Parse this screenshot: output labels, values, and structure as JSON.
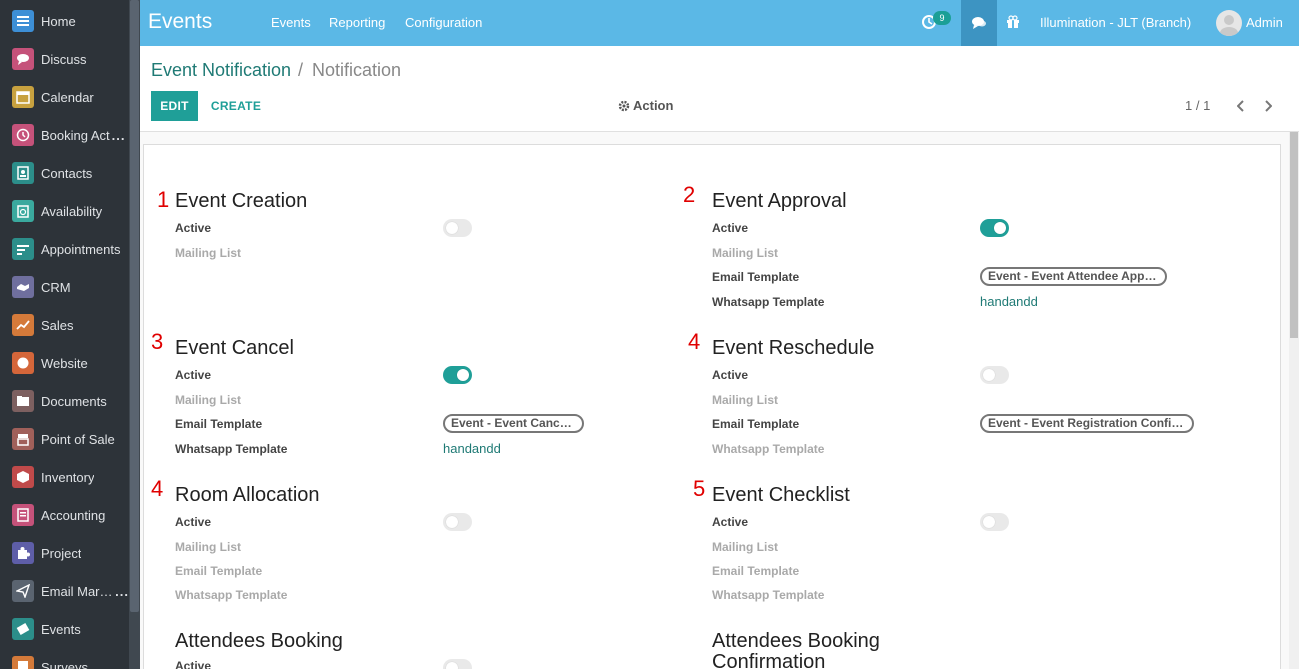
{
  "sidebar": {
    "items": [
      {
        "label": "Home",
        "icon": "home-icon",
        "color": "#3d8fd6"
      },
      {
        "label": "Discuss",
        "icon": "discuss-icon",
        "color": "#c5527a"
      },
      {
        "label": "Calendar",
        "icon": "calendar-icon",
        "color": "#c7a13f"
      },
      {
        "label": "Booking Act",
        "icon": "booking-icon",
        "color": "#c5527a",
        "more": "..."
      },
      {
        "label": "Contacts",
        "icon": "contacts-icon",
        "color": "#2c8e8a"
      },
      {
        "label": "Availability",
        "icon": "availability-icon",
        "color": "#3aa99e"
      },
      {
        "label": "Appointments",
        "icon": "appointments-icon",
        "color": "#2c8e8a"
      },
      {
        "label": "CRM",
        "icon": "crm-icon",
        "color": "#6f6f9e"
      },
      {
        "label": "Sales",
        "icon": "sales-icon",
        "color": "#d47a3a"
      },
      {
        "label": "Website",
        "icon": "website-icon",
        "color": "#d4663a"
      },
      {
        "label": "Documents",
        "icon": "documents-icon",
        "color": "#7d6060"
      },
      {
        "label": "Point of Sale",
        "icon": "pos-icon",
        "color": "#a0605a"
      },
      {
        "label": "Inventory",
        "icon": "inventory-icon",
        "color": "#c04a4a"
      },
      {
        "label": "Accounting",
        "icon": "accounting-icon",
        "color": "#c5527a"
      },
      {
        "label": "Project",
        "icon": "project-icon",
        "color": "#5e5ea8"
      },
      {
        "label": "Email Marke",
        "icon": "email-marketing-icon",
        "color": "#5a6470",
        "more": "..."
      },
      {
        "label": "Events",
        "icon": "events-icon",
        "color": "#2c8e8a"
      },
      {
        "label": "Surveys",
        "icon": "surveys-icon",
        "color": "#d47a3a"
      }
    ]
  },
  "topbar": {
    "app_title": "Events",
    "menu": [
      "Events",
      "Reporting",
      "Configuration"
    ],
    "activity_count": "9",
    "company": "Illumination - JLT (Branch)",
    "user": "Admin"
  },
  "control": {
    "breadcrumb_parent": "Event Notification",
    "breadcrumb_sep": "/",
    "breadcrumb_current": "Notification",
    "edit_label": "EDIT",
    "create_label": "CREATE",
    "action_label": "Action",
    "pager": "1 / 1"
  },
  "sections": [
    {
      "num": "1",
      "title": "Event Creation",
      "fields": {
        "active_label": "Active",
        "active": false,
        "mailing_label": "Mailing List"
      }
    },
    {
      "num": "2",
      "title": "Event Approval",
      "fields": {
        "active_label": "Active",
        "active": true,
        "mailing_label": "Mailing List",
        "email_label": "Email Template",
        "email_value": "Event - Event Attendee Approval",
        "whatsapp_label": "Whatsapp Template",
        "whatsapp_value": "handandd"
      }
    },
    {
      "num": "3",
      "title": "Event Cancel",
      "fields": {
        "active_label": "Active",
        "active": true,
        "mailing_label": "Mailing List",
        "email_label": "Email Template",
        "email_value": "Event - Event Cancelled",
        "whatsapp_label": "Whatsapp Template",
        "whatsapp_value": "handandd"
      }
    },
    {
      "num": "4",
      "title": "Event Reschedule",
      "fields": {
        "active_label": "Active",
        "active": false,
        "mailing_label": "Mailing List",
        "email_label": "Email Template",
        "email_value": "Event - Event Registration Confirm...",
        "whatsapp_label": "Whatsapp Template"
      }
    },
    {
      "num": "4",
      "title": "Room Allocation",
      "fields": {
        "active_label": "Active",
        "active": false,
        "mailing_label": "Mailing List",
        "email_label": "Email Template",
        "whatsapp_label": "Whatsapp Template"
      }
    },
    {
      "num": "5",
      "title": "Event Checklist",
      "fields": {
        "active_label": "Active",
        "active": false,
        "mailing_label": "Mailing List",
        "email_label": "Email Template",
        "whatsapp_label": "Whatsapp Template"
      }
    },
    {
      "title": "Attendees Booking",
      "fields": {
        "active_label": "Active",
        "active": false
      }
    },
    {
      "title_lines": [
        "Attendees Booking",
        "Confirmation"
      ]
    }
  ],
  "colors": {
    "accent": "#1f9f98",
    "topbar": "#5bb8e6",
    "sidebar": "#2d3339",
    "marker": "#e00000"
  }
}
